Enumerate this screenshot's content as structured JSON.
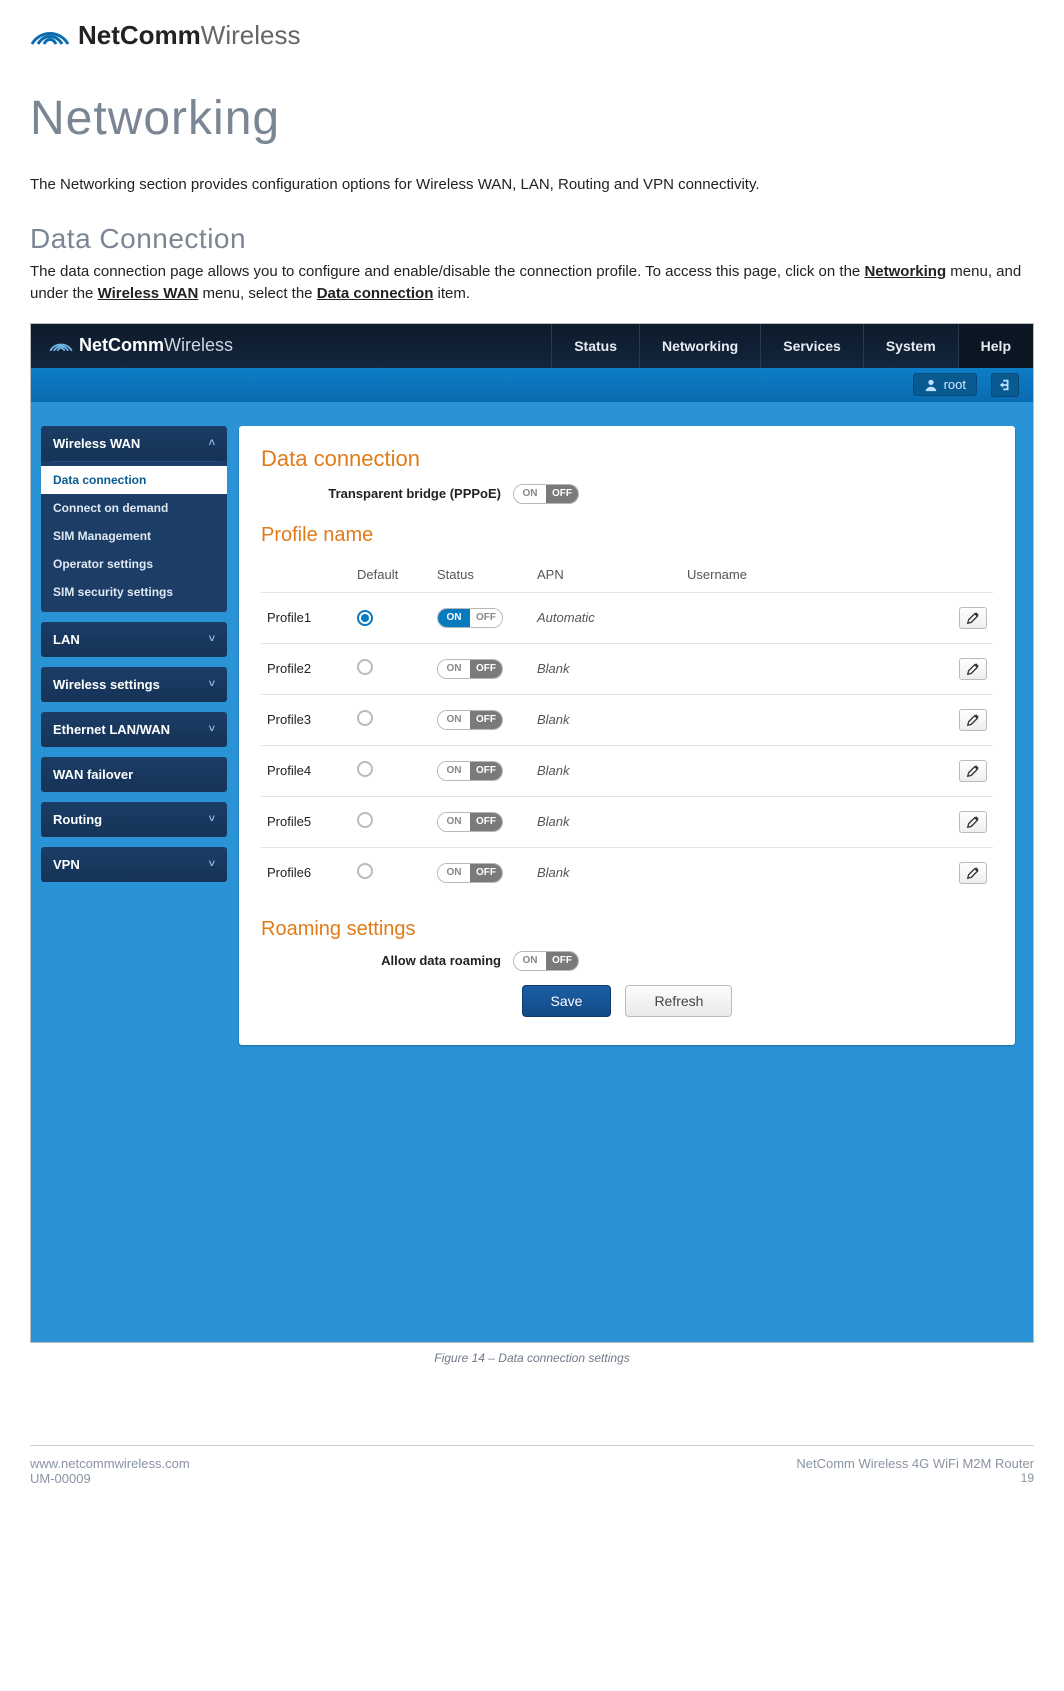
{
  "doc_logo": {
    "bold": "NetComm",
    "light": "Wireless"
  },
  "h1": "Networking",
  "intro": "The Networking section provides configuration options for Wireless WAN, LAN, Routing and VPN connectivity.",
  "h2": "Data Connection",
  "para2_pre": "The data connection page allows you to configure and enable/disable the connection profile. To access this page, click on the ",
  "para2_b1": "Networking",
  "para2_mid1": " menu, and under the ",
  "para2_b2": "Wireless WAN",
  "para2_mid2": " menu, select the ",
  "para2_b3": "Data connection",
  "para2_end": " item.",
  "app": {
    "logo": {
      "bold": "NetComm",
      "light": "Wireless"
    },
    "nav": {
      "status": "Status",
      "networking": "Networking",
      "services": "Services",
      "system": "System",
      "help": "Help"
    },
    "user": "root",
    "sidebar": {
      "wwan": {
        "title": "Wireless WAN",
        "items": [
          "Data connection",
          "Connect on demand",
          "SIM Management",
          "Operator settings",
          "SIM security settings"
        ]
      },
      "lan": "LAN",
      "wireless": "Wireless settings",
      "eth": "Ethernet LAN/WAN",
      "wanfail": "WAN failover",
      "routing": "Routing",
      "vpn": "VPN"
    },
    "panel": {
      "title": "Data connection",
      "bridge_label": "Transparent bridge (PPPoE)",
      "profile_heading": "Profile name",
      "columns": {
        "default": "Default",
        "status": "Status",
        "apn": "APN",
        "username": "Username"
      },
      "profiles": [
        {
          "name": "Profile1",
          "default": true,
          "status": "ON",
          "apn": "Automatic",
          "username": ""
        },
        {
          "name": "Profile2",
          "default": false,
          "status": "OFF",
          "apn": "Blank",
          "username": ""
        },
        {
          "name": "Profile3",
          "default": false,
          "status": "OFF",
          "apn": "Blank",
          "username": ""
        },
        {
          "name": "Profile4",
          "default": false,
          "status": "OFF",
          "apn": "Blank",
          "username": ""
        },
        {
          "name": "Profile5",
          "default": false,
          "status": "OFF",
          "apn": "Blank",
          "username": ""
        },
        {
          "name": "Profile6",
          "default": false,
          "status": "OFF",
          "apn": "Blank",
          "username": ""
        }
      ],
      "on_text": "ON",
      "off_text": "OFF",
      "roaming_heading": "Roaming settings",
      "roaming_label": "Allow data roaming",
      "save": "Save",
      "refresh": "Refresh"
    }
  },
  "figure_caption": "Figure 14 – Data connection settings",
  "footer": {
    "url": "www.netcommwireless.com",
    "docid": "UM-00009",
    "product": "NetComm Wireless 4G WiFi M2M Router",
    "page": "19"
  }
}
